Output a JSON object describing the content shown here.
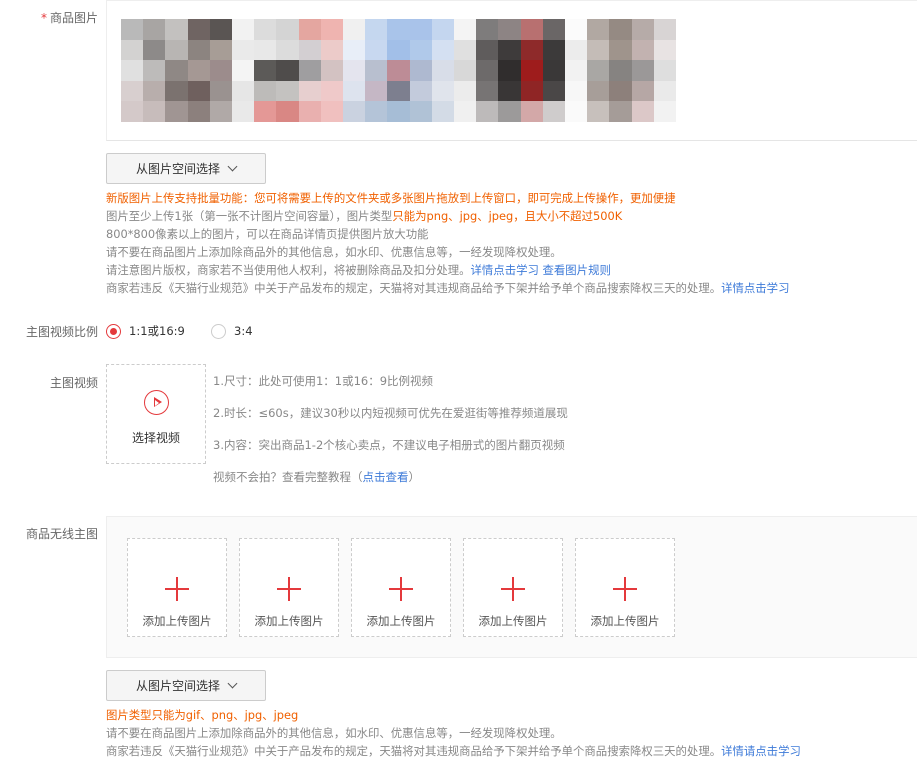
{
  "product_images": {
    "label": "商品图片",
    "required_mark": "*",
    "select_button": "从图片空间选择",
    "notes": {
      "line1": "新版图片上传支持批量功能：您可将需要上传的文件夹或多张图片拖放到上传窗口，即可完成上传操作，更加便捷",
      "line2_a": "图片至少上传1张（第一张不计图片空间容量），图片类型",
      "line2_b": "只能为png、jpg、jpeg，且大小不超过500K",
      "line3": "800*800像素以上的图片，可以在商品详情页提供图片放大功能",
      "line4": "请不要在商品图片上添加除商品外的其他信息，如水印、优惠信息等，一经发现降权处理。",
      "line5_a": "请注意图片版权，商家若不当使用他人权利，将被删除商品及扣分处理。",
      "line5_link1": "详情点击学习",
      "line5_link2": "查看图片规则",
      "line6_a": "商家若违反《天猫行业规范》中关于产品发布的规定，天猫将对其违规商品给予下架并给予单个商品搜索降权三天的处理。",
      "line6_link": "详情点击学习"
    }
  },
  "video_ratio": {
    "label": "主图视频比例",
    "options": [
      "1:1或16:9",
      "3:4"
    ],
    "selected": "1:1或16:9"
  },
  "main_video": {
    "label": "主图视频",
    "select_label": "选择视频",
    "tips": [
      "1.尺寸：此处可使用1：1或16：9比例视频",
      "2.时长：≤60s，建议30秒以内短视频可优先在爱逛街等推荐频道展现",
      "3.内容：突出商品1-2个核心卖点，不建议电子相册式的图片翻页视频"
    ],
    "help_a": "视频不会拍？查看完整教程（",
    "help_link": "点击查看",
    "help_b": "）"
  },
  "wireless_images": {
    "label": "商品无线主图",
    "slot_label": "添加上传图片",
    "select_button": "从图片空间选择",
    "notes": {
      "line1": "图片类型只能为gif、png、jpg、jpeg",
      "line2": "请不要在商品图片上添加除商品外的其他信息，如水印、优惠信息等，一经发现降权处理。",
      "line3_a": "商家若违反《天猫行业规范》中关于产品发布的规定，天猫将对其违规商品给予下架并给予单个商品搜索降权三天的处理。",
      "line3_link": "详情请点击学习"
    }
  },
  "colors": {
    "accent": "#e4393c",
    "orange": "#f06000",
    "link": "#3d7ad8"
  }
}
